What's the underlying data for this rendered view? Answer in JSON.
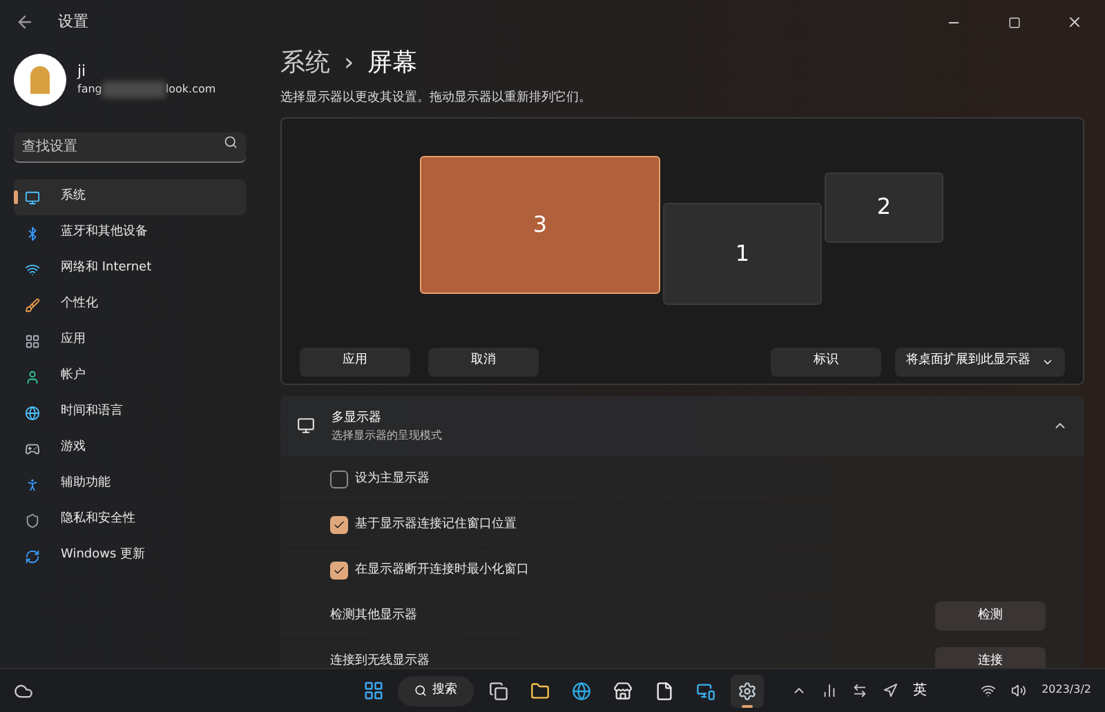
{
  "window": {
    "title": "设置"
  },
  "account": {
    "name": "ji",
    "email_start": "fang",
    "email_end": "look.com"
  },
  "search": {
    "placeholder": "查找设置"
  },
  "sidebar": {
    "items": [
      {
        "label": "系统",
        "selected": true
      },
      {
        "label": "蓝牙和其他设备",
        "selected": false
      },
      {
        "label": "网络和 Internet",
        "selected": false
      },
      {
        "label": "个性化",
        "selected": false
      },
      {
        "label": "应用",
        "selected": false
      },
      {
        "label": "帐户",
        "selected": false
      },
      {
        "label": "时间和语言",
        "selected": false
      },
      {
        "label": "游戏",
        "selected": false
      },
      {
        "label": "辅助功能",
        "selected": false
      },
      {
        "label": "隐私和安全性",
        "selected": false
      },
      {
        "label": "Windows 更新",
        "selected": false
      }
    ]
  },
  "breadcrumb": {
    "parent": "系统",
    "separator": "›",
    "current": "屏幕"
  },
  "hint": "选择显示器以更改其设置。拖动显示器以重新排列它们。",
  "displays": [
    {
      "label": "3",
      "selected": true
    },
    {
      "label": "1",
      "selected": false
    },
    {
      "label": "2",
      "selected": false
    }
  ],
  "arrange_buttons": {
    "apply": "应用",
    "cancel": "取消",
    "identify": "标识",
    "mode": "将桌面扩展到此显示器"
  },
  "multi_display": {
    "title": "多显示器",
    "subtitle": "选择显示器的呈现模式",
    "expanded": true,
    "rows": [
      {
        "kind": "checkbox",
        "label": "设为主显示器",
        "checked": false
      },
      {
        "kind": "checkbox",
        "label": "基于显示器连接记住窗口位置",
        "checked": true
      },
      {
        "kind": "checkbox",
        "label": "在显示器断开连接时最小化窗口",
        "checked": true
      },
      {
        "kind": "button",
        "label": "检测其他显示器",
        "button": "检测"
      },
      {
        "kind": "button",
        "label": "连接到无线显示器",
        "button": "连接"
      }
    ]
  },
  "taskbar": {
    "search": "搜索",
    "apps": [
      {
        "active": false
      },
      {
        "active": false
      },
      {
        "active": false
      },
      {
        "active": false
      },
      {
        "active": false
      },
      {
        "active": false
      },
      {
        "active": true
      }
    ],
    "ime": "英",
    "date": "2023/3/2"
  }
}
